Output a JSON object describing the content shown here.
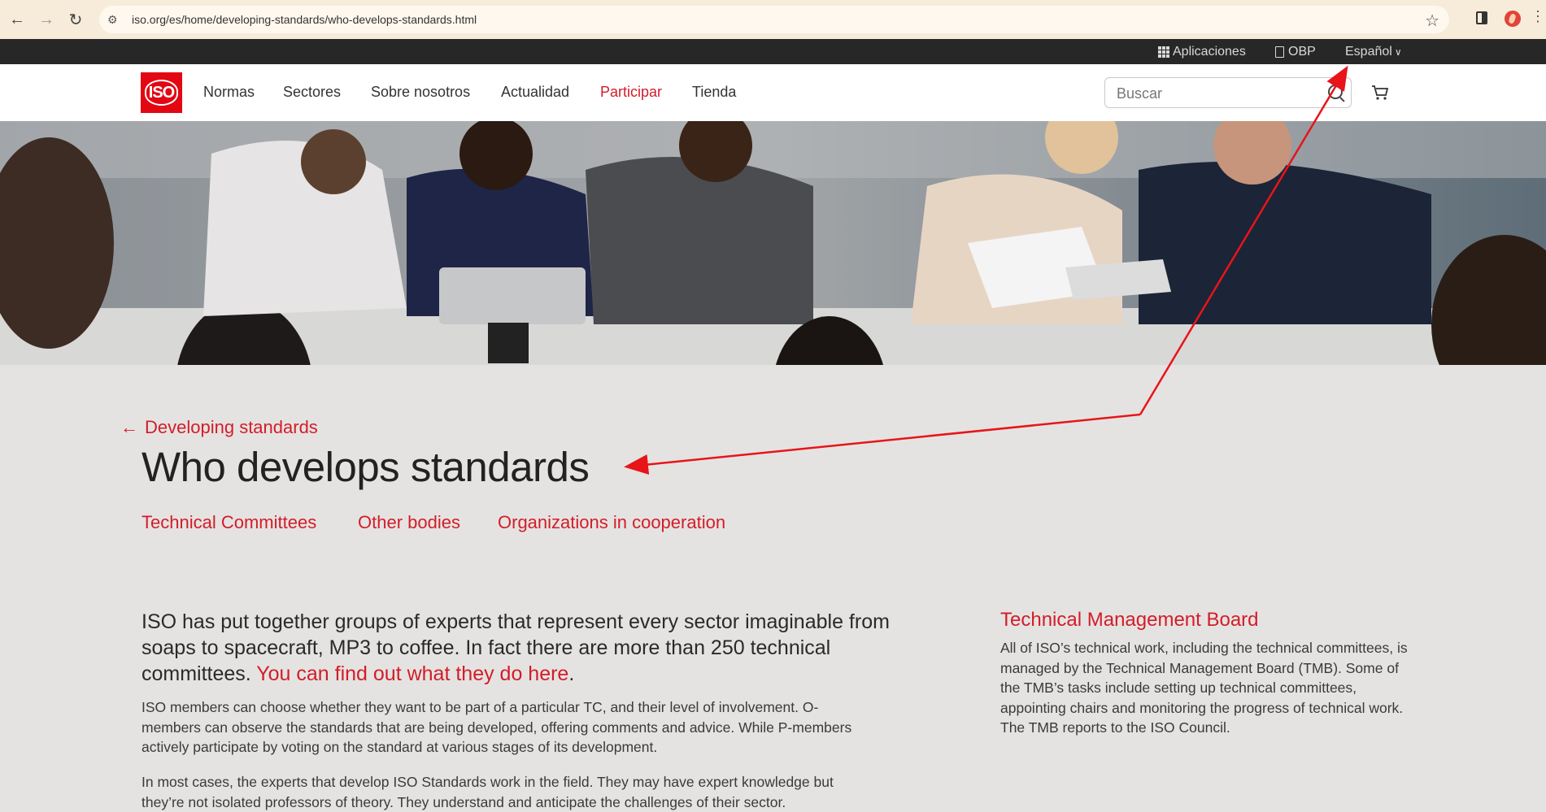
{
  "browser": {
    "url": "iso.org/es/home/developing-standards/who-develops-standards.html"
  },
  "topbar": {
    "apps": "Aplicaciones",
    "obp": "OBP",
    "language": "Español"
  },
  "header": {
    "logo_text": "ISO",
    "nav": [
      "Normas",
      "Sectores",
      "Sobre nosotros",
      "Actualidad",
      "Participar",
      "Tienda"
    ],
    "active_nav": "Participar",
    "search_placeholder": "Buscar"
  },
  "page": {
    "back_link": "Developing standards",
    "title": "Who develops standards",
    "tabs": [
      "Technical Committees",
      "Other bodies",
      "Organizations in cooperation"
    ],
    "lead_text": "ISO has put together groups of experts that represent every sector imaginable from soaps to spacecraft, MP3 to coffee. In fact there are more than 250 technical committees. ",
    "lead_link": "You can find out what they do here",
    "lead_end": ".",
    "paragraph_1": "ISO members can choose whether they want to be part of a particular TC, and their level of involvement. O-members can observe the standards that are being developed, offering comments and advice. While P-members actively participate by voting on the standard at various stages of its development.",
    "paragraph_2": "In most cases, the experts that develop ISO Standards work in the field. They may have expert knowledge but they’re not isolated professors of theory. They understand and anticipate the challenges of their sector."
  },
  "aside": {
    "title": "Technical Management Board",
    "text": "All of ISO’s technical work, including the technical committees, is managed by the Technical Management Board (TMB). Some of the TMB’s tasks include setting up technical committees, appointing chairs and monitoring the progress of technical work. The TMB reports to the ISO Council."
  },
  "colors": {
    "accent": "#d21d2a",
    "logo": "#e30613",
    "annotation": "#e8141a"
  }
}
